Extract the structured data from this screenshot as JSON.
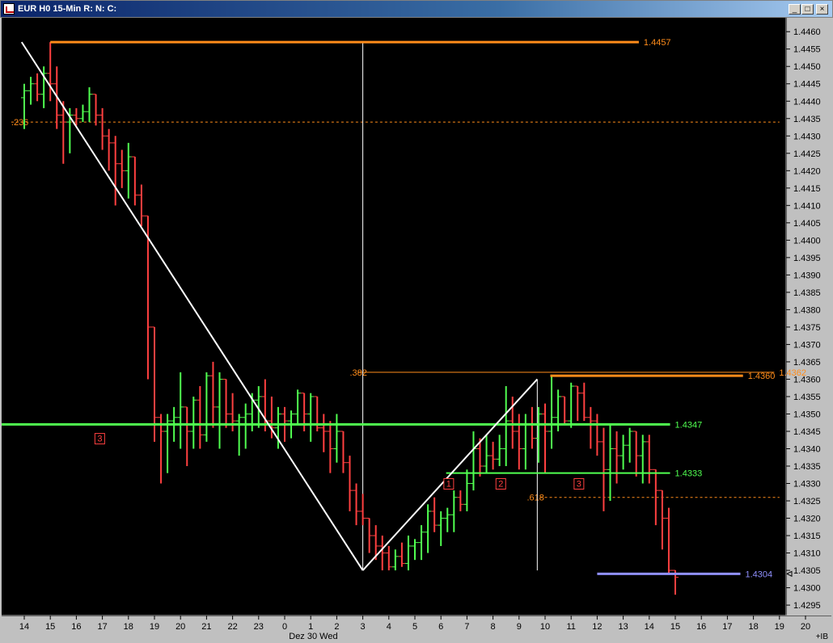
{
  "window": {
    "title": "EUR H0 15-Min R: N: C:",
    "icon": "chart-app-icon",
    "minimize_label": "_",
    "maximize_label": "□",
    "close_label": "×"
  },
  "chart_data": {
    "type": "ohlc",
    "title": "EUR H0 15-Min",
    "ylim": [
      1.4292,
      1.4464
    ],
    "y_ticks": [
      1.446,
      1.4455,
      1.445,
      1.4445,
      1.444,
      1.4435,
      1.443,
      1.4425,
      1.442,
      1.4415,
      1.441,
      1.4405,
      1.44,
      1.4395,
      1.439,
      1.4385,
      1.438,
      1.4375,
      1.437,
      1.4365,
      1.436,
      1.4355,
      1.435,
      1.4345,
      1.434,
      1.4335,
      1.433,
      1.4325,
      1.432,
      1.4315,
      1.431,
      1.4305,
      1.43,
      1.4295
    ],
    "x_ticks": [
      "14",
      "15",
      "16",
      "17",
      "18",
      "19",
      "20",
      "21",
      "22",
      "23",
      "0",
      "1",
      "2",
      "3",
      "4",
      "5",
      "6",
      "7",
      "8",
      "9",
      "10",
      "11",
      "12",
      "13",
      "14",
      "15",
      "16",
      "17",
      "18",
      "19",
      "20"
    ],
    "date_label": "Dez 30 Wed",
    "corner_label": "+IB",
    "bar_colors": {
      "up": "#50ff50",
      "down": "#ff4040"
    },
    "series": [
      {
        "x": 0,
        "values": [
          [
            1.4441,
            1.4445,
            1.4432,
            1.4443
          ],
          [
            1.4443,
            1.4447,
            1.4439,
            1.4445
          ],
          [
            1.4445,
            1.4448,
            1.444,
            1.4442
          ],
          [
            1.4442,
            1.445,
            1.4438,
            1.4448
          ],
          [
            1.4448,
            1.4457,
            1.444,
            1.4445
          ],
          [
            1.4445,
            1.445,
            1.4432,
            1.4436
          ],
          [
            1.4436,
            1.444,
            1.4422,
            1.4434
          ],
          [
            1.4434,
            1.4438,
            1.4425,
            1.4436
          ],
          [
            1.4436,
            1.4438,
            1.4433,
            1.4435
          ],
          [
            1.4435,
            1.4439,
            1.4434,
            1.4437
          ],
          [
            1.4437,
            1.4444,
            1.4434,
            1.4442
          ],
          [
            1.4442,
            1.4442,
            1.4433,
            1.4436
          ],
          [
            1.4436,
            1.4438,
            1.4426,
            1.443
          ],
          [
            1.443,
            1.4432,
            1.442,
            1.4428
          ],
          [
            1.4428,
            1.443,
            1.441,
            1.4422
          ],
          [
            1.4422,
            1.4426,
            1.4415,
            1.442
          ],
          [
            1.442,
            1.4428,
            1.4412,
            1.4424
          ],
          [
            1.4424,
            1.4424,
            1.441,
            1.4413
          ],
          [
            1.4413,
            1.4416,
            1.4404,
            1.4407
          ],
          [
            1.4407,
            1.4407,
            1.436,
            1.4375
          ],
          [
            1.4375,
            1.4375,
            1.4342,
            1.4349
          ],
          [
            1.4349,
            1.435,
            1.433,
            1.4345
          ],
          [
            1.4345,
            1.435,
            1.4333,
            1.4348
          ],
          [
            1.4348,
            1.4352,
            1.4342,
            1.4349
          ],
          [
            1.4349,
            1.4362,
            1.434,
            1.4352
          ],
          [
            1.4352,
            1.4352,
            1.4335,
            1.4345
          ],
          [
            1.4345,
            1.4355,
            1.434,
            1.4354
          ],
          [
            1.4354,
            1.4358,
            1.434,
            1.4344
          ],
          [
            1.4344,
            1.4362,
            1.4342,
            1.4361
          ],
          [
            1.4361,
            1.4365,
            1.4346,
            1.4352
          ],
          [
            1.4352,
            1.4362,
            1.434,
            1.436
          ],
          [
            1.436,
            1.436,
            1.4346,
            1.435
          ],
          [
            1.435,
            1.4356,
            1.4345,
            1.4348
          ],
          [
            1.4348,
            1.435,
            1.4338,
            1.4349
          ],
          [
            1.4349,
            1.4353,
            1.434,
            1.435
          ],
          [
            1.435,
            1.4356,
            1.4345,
            1.4354
          ],
          [
            1.4354,
            1.4358,
            1.4346,
            1.4355
          ],
          [
            1.4355,
            1.436,
            1.4345,
            1.4348
          ],
          [
            1.4348,
            1.4355,
            1.4343,
            1.4346
          ],
          [
            1.4346,
            1.4352,
            1.434,
            1.435
          ],
          [
            1.435,
            1.4352,
            1.4342,
            1.4348
          ],
          [
            1.4348,
            1.4351,
            1.4343,
            1.435
          ],
          [
            1.435,
            1.4357,
            1.4347,
            1.4356
          ],
          [
            1.4356,
            1.4356,
            1.4345,
            1.435
          ],
          [
            1.435,
            1.4356,
            1.4342,
            1.4355
          ],
          [
            1.4355,
            1.4355,
            1.4345,
            1.4346
          ],
          [
            1.4346,
            1.435,
            1.4339,
            1.4345
          ],
          [
            1.4345,
            1.4348,
            1.4333,
            1.434
          ],
          [
            1.434,
            1.435,
            1.4336,
            1.4345
          ],
          [
            1.4345,
            1.4345,
            1.4333,
            1.4336
          ],
          [
            1.4336,
            1.4338,
            1.4322,
            1.4328
          ],
          [
            1.4328,
            1.433,
            1.4318,
            1.4322
          ],
          [
            1.4322,
            1.4327,
            1.4318,
            1.432
          ],
          [
            1.432,
            1.432,
            1.431,
            1.4315
          ],
          [
            1.4315,
            1.4318,
            1.4308,
            1.4312
          ],
          [
            1.4312,
            1.4315,
            1.4305,
            1.431
          ],
          [
            1.431,
            1.4312,
            1.4305,
            1.4306
          ],
          [
            1.4306,
            1.4311,
            1.4305,
            1.4309
          ],
          [
            1.4309,
            1.4313,
            1.4306,
            1.4307
          ],
          [
            1.4307,
            1.4315,
            1.4305,
            1.4312
          ],
          [
            1.4312,
            1.4314,
            1.4308,
            1.4313
          ],
          [
            1.4313,
            1.4318,
            1.4308,
            1.4316
          ],
          [
            1.4316,
            1.4324,
            1.431,
            1.4322
          ],
          [
            1.4322,
            1.4326,
            1.4316,
            1.4318
          ],
          [
            1.4318,
            1.4322,
            1.4312,
            1.432
          ],
          [
            1.432,
            1.4323,
            1.4316,
            1.4321
          ],
          [
            1.4321,
            1.4328,
            1.4316,
            1.4326
          ],
          [
            1.4326,
            1.4328,
            1.4322,
            1.4324
          ],
          [
            1.4324,
            1.4334,
            1.4322,
            1.433
          ],
          [
            1.433,
            1.4345,
            1.4328,
            1.434
          ],
          [
            1.434,
            1.4343,
            1.4332,
            1.4335
          ],
          [
            1.4335,
            1.4344,
            1.4333,
            1.4338
          ],
          [
            1.4338,
            1.4342,
            1.4334,
            1.4337
          ],
          [
            1.4337,
            1.4344,
            1.4335,
            1.434
          ],
          [
            1.434,
            1.4358,
            1.4335,
            1.4348
          ],
          [
            1.4348,
            1.4355,
            1.434,
            1.4345
          ],
          [
            1.4345,
            1.435,
            1.4334,
            1.434
          ],
          [
            1.434,
            1.435,
            1.4334,
            1.4347
          ],
          [
            1.4347,
            1.4352,
            1.434,
            1.4343
          ],
          [
            1.4343,
            1.4352,
            1.4336,
            1.435
          ],
          [
            1.435,
            1.4353,
            1.4333,
            1.4345
          ],
          [
            1.4345,
            1.4361,
            1.434,
            1.4349
          ],
          [
            1.4349,
            1.4357,
            1.4345,
            1.4355
          ],
          [
            1.4355,
            1.4355,
            1.4347,
            1.4348
          ],
          [
            1.4348,
            1.4359,
            1.4346,
            1.4358
          ],
          [
            1.4358,
            1.4358,
            1.4348,
            1.4356
          ],
          [
            1.4356,
            1.4359,
            1.4348,
            1.4349
          ],
          [
            1.4349,
            1.4352,
            1.434,
            1.4348
          ],
          [
            1.4348,
            1.435,
            1.4338,
            1.4342
          ],
          [
            1.4342,
            1.4346,
            1.4322,
            1.4334
          ],
          [
            1.4334,
            1.4347,
            1.4325,
            1.434
          ],
          [
            1.434,
            1.4345,
            1.433,
            1.4338
          ],
          [
            1.4338,
            1.4344,
            1.4334,
            1.4341
          ],
          [
            1.4341,
            1.4346,
            1.4336,
            1.4345
          ],
          [
            1.4345,
            1.4345,
            1.4332,
            1.4338
          ],
          [
            1.4338,
            1.4344,
            1.433,
            1.4342
          ],
          [
            1.4342,
            1.4344,
            1.433,
            1.4334
          ],
          [
            1.4334,
            1.4334,
            1.4318,
            1.4328
          ],
          [
            1.4328,
            1.4328,
            1.4311,
            1.432
          ],
          [
            1.432,
            1.4323,
            1.4304,
            1.4305
          ],
          [
            1.4305,
            1.4305,
            1.4298,
            1.4303
          ]
        ]
      }
    ],
    "horizontal_lines": [
      {
        "name": "resistance-1.4457",
        "y": 1.4457,
        "x_start": 1.0,
        "x_end": 23.6,
        "color": "#ff8c1a",
        "label": "1.4457",
        "weight": 3
      },
      {
        "name": "resistance-1.4360",
        "y": 1.4361,
        "x_start": 20.2,
        "x_end": 27.6,
        "color": "#ff8c1a",
        "label": "1.4360",
        "weight": 3
      },
      {
        "name": "support-1.4347",
        "y": 1.4347,
        "x_start": -1.0,
        "x_end": 24.8,
        "color": "#50ff50",
        "label": "1.4347",
        "weight": 3
      },
      {
        "name": "support-1.4333",
        "y": 1.4333,
        "x_start": 16.2,
        "x_end": 24.8,
        "color": "#50ff50",
        "label": "1.4333",
        "weight": 2
      },
      {
        "name": "current-1.4304",
        "y": 1.4304,
        "x_start": 22.0,
        "x_end": 27.5,
        "color": "#9090ff",
        "label": "1.4304",
        "weight": 3
      }
    ],
    "fib_lines": [
      {
        "name": "fib-236",
        "y": 1.4434,
        "x_start": -0.5,
        "x_end": 29.0,
        "color": "#ff8c1a",
        "label": ".236",
        "label_x": -0.5
      },
      {
        "name": "fib-382",
        "y": 1.4362,
        "x_start": 12.8,
        "x_end": 28.8,
        "color": "#ff8c1a",
        "label": ".382",
        "label_x": 12.5,
        "right_label": "1.4362"
      },
      {
        "name": "fib-618",
        "y": 1.4326,
        "x_start": 19.8,
        "x_end": 29.0,
        "color": "#ff8c1a",
        "label": ".618",
        "label_x": 19.3
      }
    ],
    "trend_lines": [
      {
        "name": "trend-down",
        "x1": -0.1,
        "y1": 1.4457,
        "x2": 13.0,
        "y2": 1.4305
      },
      {
        "name": "trend-up",
        "x1": 13.0,
        "y1": 1.4305,
        "x2": 19.7,
        "y2": 1.436
      }
    ],
    "vertical_lines": [
      {
        "name": "cursor-line-1",
        "x": 13.0,
        "y_top": 1.4457,
        "y_bottom": 1.4305
      },
      {
        "name": "cursor-line-2",
        "x": 19.7,
        "y_top": 1.436,
        "y_bottom": 1.4305
      }
    ],
    "markers": [
      {
        "name": "marker-3-left",
        "label": "3",
        "x": 2.9,
        "y": 1.4343
      },
      {
        "name": "marker-1",
        "label": "1",
        "x": 16.3,
        "y": 1.433
      },
      {
        "name": "marker-2",
        "label": "2",
        "x": 18.3,
        "y": 1.433
      },
      {
        "name": "marker-3-right",
        "label": "3",
        "x": 21.3,
        "y": 1.433
      }
    ]
  }
}
